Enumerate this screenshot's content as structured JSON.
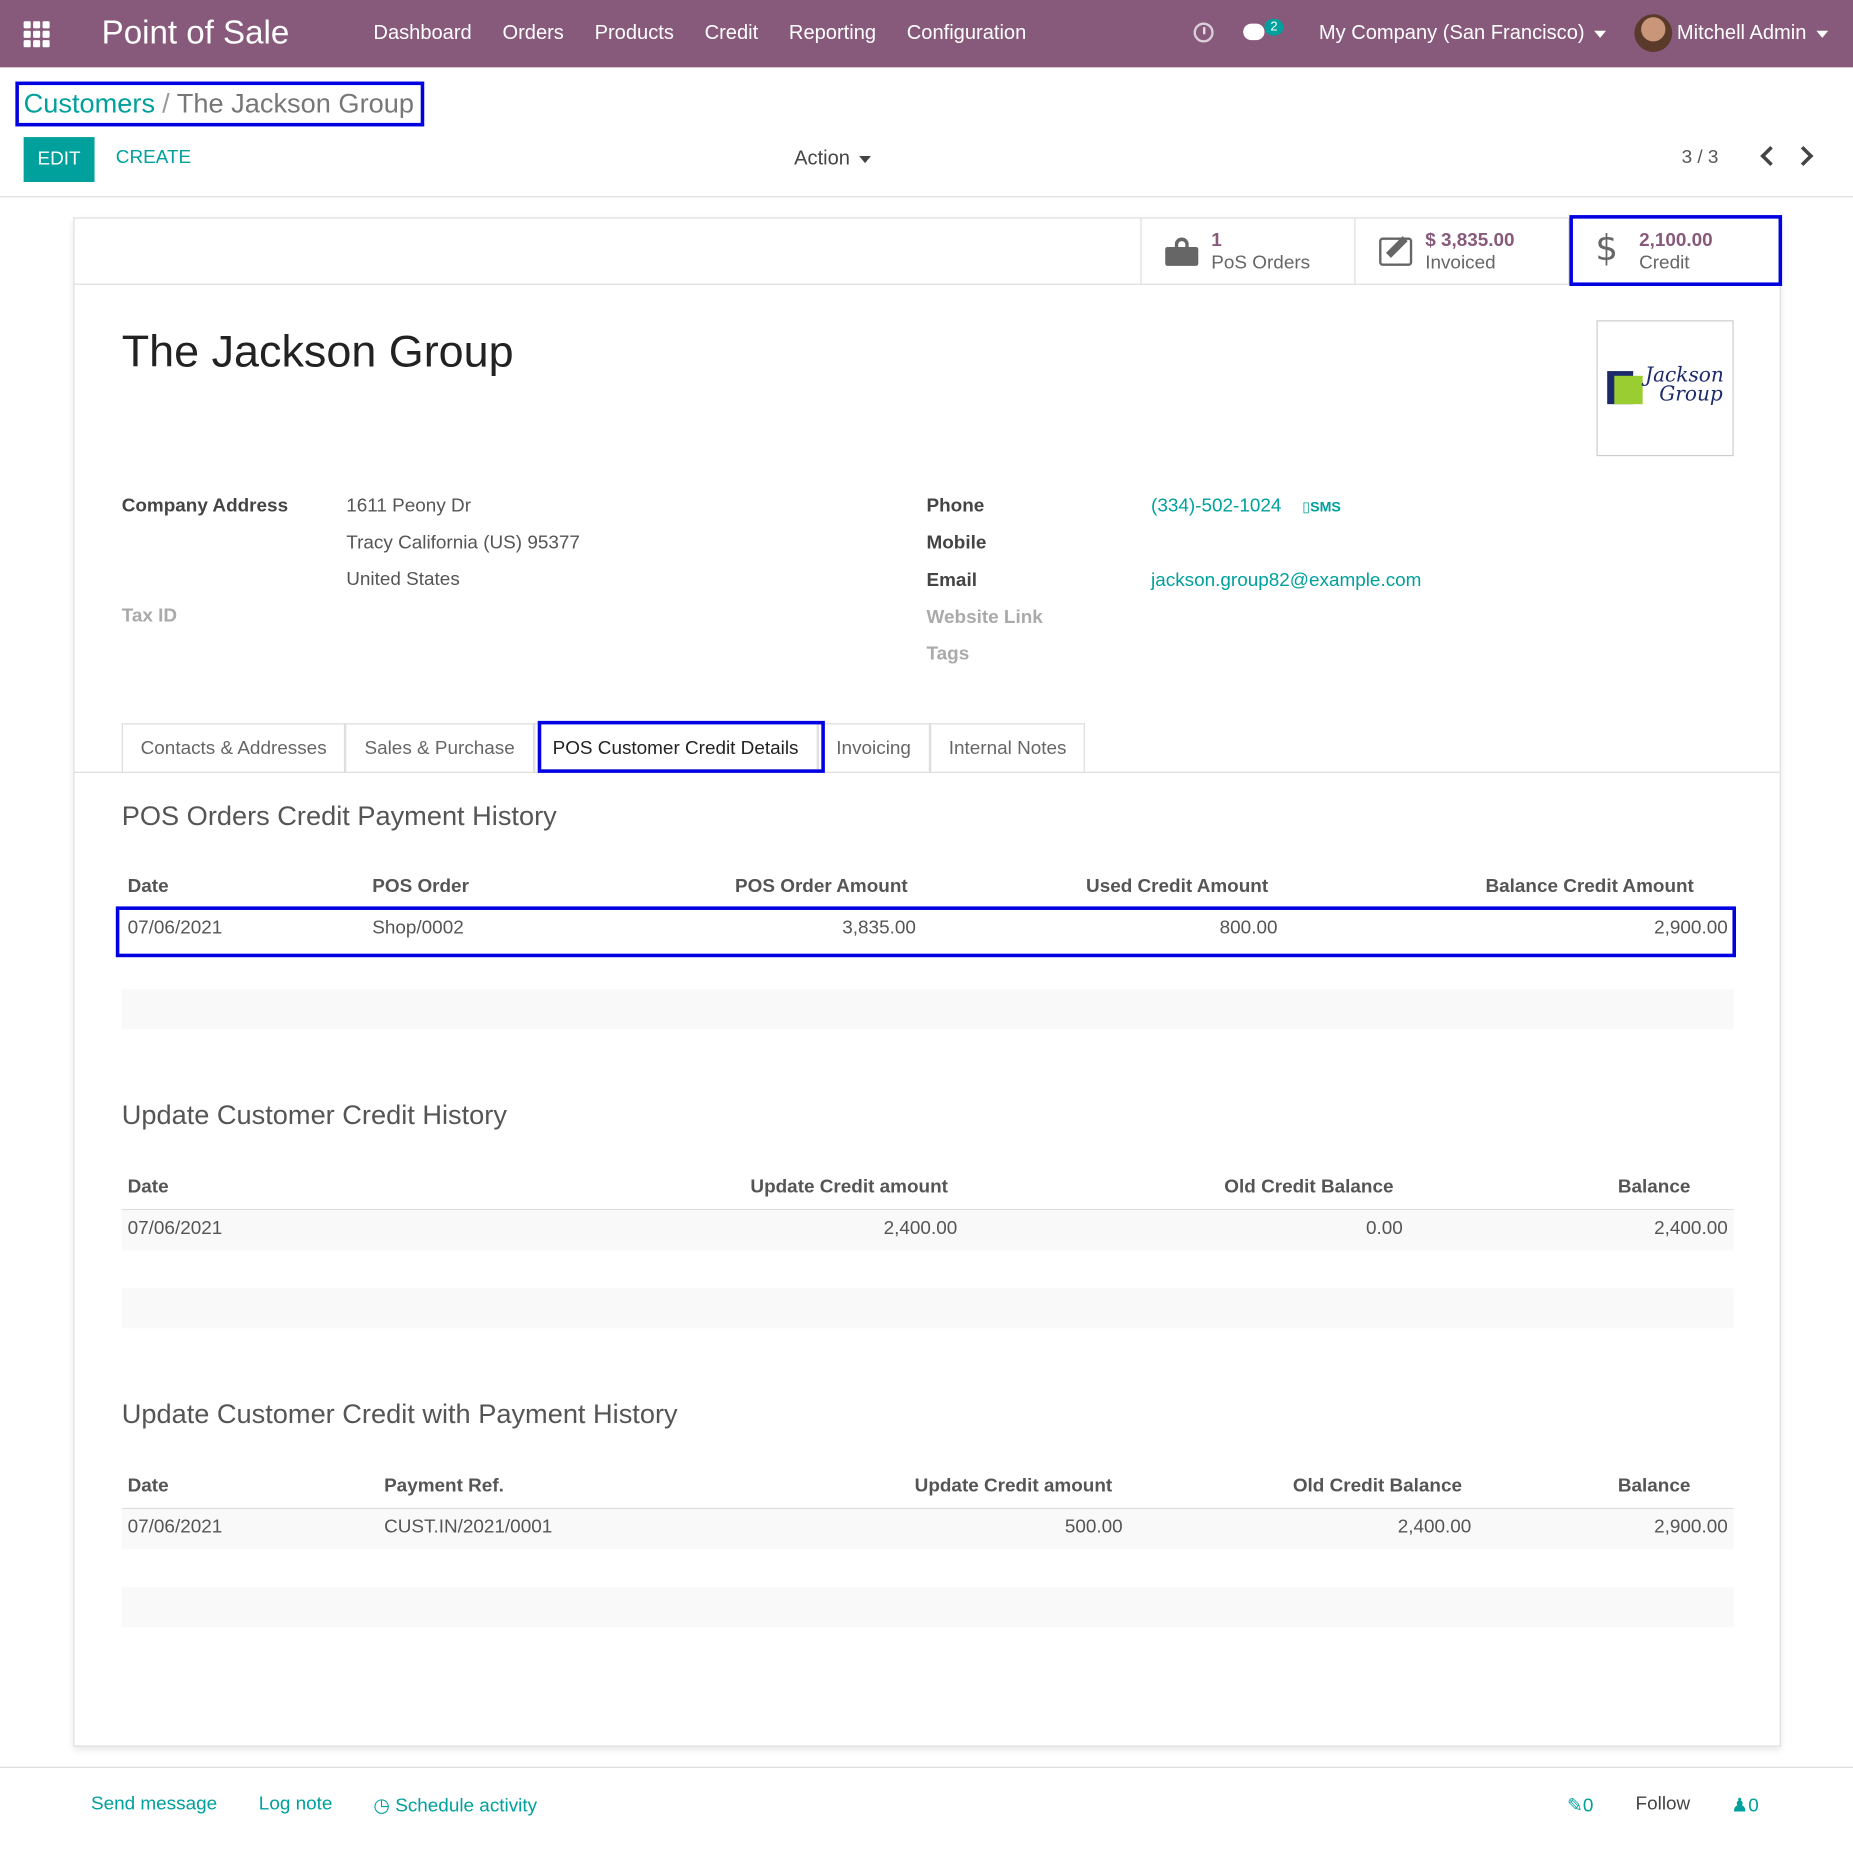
{
  "navbar": {
    "app_title": "Point of Sale",
    "menu": [
      "Dashboard",
      "Orders",
      "Products",
      "Credit",
      "Reporting",
      "Configuration"
    ],
    "chat_badge": "2",
    "company": "My Company (San Francisco)",
    "user": "Mitchell Admin"
  },
  "breadcrumb": {
    "parent": "Customers",
    "separator": "/",
    "current": "The Jackson Group"
  },
  "control_panel": {
    "edit_label": "EDIT",
    "create_label": "CREATE",
    "action_label": "Action",
    "pager": "3 / 3"
  },
  "stat_buttons": [
    {
      "value": "1",
      "label": "PoS Orders",
      "icon": "shopping-bag-icon"
    },
    {
      "value": "$ 3,835.00",
      "label": "Invoiced",
      "icon": "pencil-square-icon"
    },
    {
      "value": "2,100.00",
      "label": "Credit",
      "icon": "dollar-icon"
    }
  ],
  "partner": {
    "name": "The Jackson Group",
    "logo_text": [
      "Jackson",
      "Group"
    ],
    "fields_left": {
      "company_address_label": "Company Address",
      "address_line1": "1611 Peony Dr",
      "address_line2": "Tracy  California (US)  95377",
      "address_line3": "United States",
      "tax_id_label": "Tax ID"
    },
    "fields_right": {
      "phone_label": "Phone",
      "phone_value": "(334)-502-1024",
      "sms_label": "SMS",
      "mobile_label": "Mobile",
      "email_label": "Email",
      "email_value": "jackson.group82@example.com",
      "website_label": "Website Link",
      "tags_label": "Tags"
    }
  },
  "tabs": [
    "Contacts & Addresses",
    "Sales & Purchase",
    "POS Customer Credit Details",
    "Invoicing",
    "Internal Notes"
  ],
  "active_tab": "POS Customer Credit Details",
  "pos_history": {
    "title": "POS Orders Credit Payment History",
    "headers": [
      "Date",
      "POS Order",
      "POS Order Amount",
      "Used Credit Amount",
      "Balance Credit Amount"
    ],
    "rows": [
      [
        "07/06/2021",
        "Shop/0002",
        "3,835.00",
        "800.00",
        "2,900.00"
      ]
    ]
  },
  "credit_history": {
    "title": "Update Customer Credit History",
    "headers": [
      "Date",
      "Update Credit amount",
      "Old Credit Balance",
      "Balance"
    ],
    "rows": [
      [
        "07/06/2021",
        "2,400.00",
        "0.00",
        "2,400.00"
      ]
    ]
  },
  "payment_history": {
    "title": "Update Customer Credit with Payment History",
    "headers": [
      "Date",
      "Payment Ref.",
      "Update Credit amount",
      "Old Credit Balance",
      "Balance"
    ],
    "rows": [
      [
        "07/06/2021",
        "CUST.IN/2021/0001",
        "500.00",
        "2,400.00",
        "2,900.00"
      ]
    ]
  },
  "chatter": {
    "send_message": "Send message",
    "log_note": "Log note",
    "schedule_activity": "Schedule activity",
    "attachments_count": "0",
    "follow": "Follow",
    "followers_count": "0"
  },
  "colors": {
    "brand": "#875a7b",
    "accent": "#00a09d",
    "highlight_box": "#0000e0"
  }
}
